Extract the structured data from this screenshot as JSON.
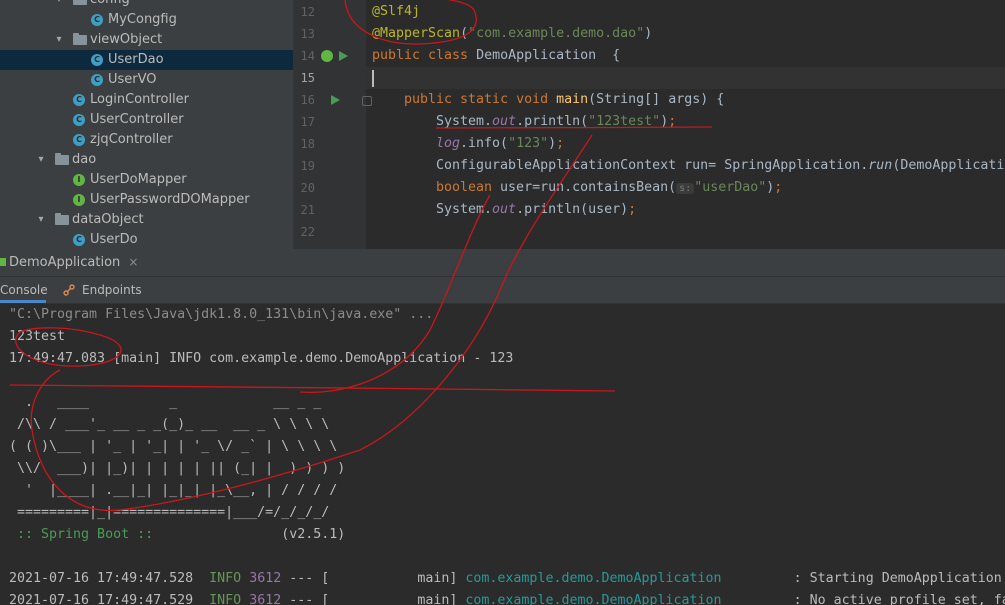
{
  "project_tree": {
    "items": [
      {
        "label": "config",
        "type": "folder",
        "expanded": true
      },
      {
        "label": "MyCongfig",
        "type": "class"
      },
      {
        "label": "viewObject",
        "type": "folder",
        "expanded": true
      },
      {
        "label": "UserDao",
        "type": "class",
        "selected": true
      },
      {
        "label": "UserVO",
        "type": "class"
      },
      {
        "label": "LoginController",
        "type": "class"
      },
      {
        "label": "UserController",
        "type": "class"
      },
      {
        "label": "zjqController",
        "type": "class"
      },
      {
        "label": "dao",
        "type": "folder",
        "expanded": true
      },
      {
        "label": "UserDoMapper",
        "type": "interface"
      },
      {
        "label": "UserPasswordDOMapper",
        "type": "interface"
      },
      {
        "label": "dataObject",
        "type": "folder",
        "expanded": true
      },
      {
        "label": "UserDo",
        "type": "class"
      }
    ]
  },
  "editor": {
    "line_numbers": [
      "12",
      "13",
      "14",
      "15",
      "16",
      "17",
      "18",
      "19",
      "20",
      "21",
      "22"
    ],
    "current_line": "15",
    "code": {
      "l12_ann": "@Slf4j",
      "l13_ann": "@MapperScan",
      "l13_open": "(",
      "l13_str": "\"com.example.demo.dao\"",
      "l13_close": ")",
      "l14_kw": "public class ",
      "l14_name": "DemoApplication  {",
      "l16_kw": "public static void ",
      "l16_fn": "main",
      "l16_rest": "(String[] args) {",
      "l17_a": "System.",
      "l17_b": "out",
      "l17_c": ".println(",
      "l17_d": "\"123test\"",
      "l17_e": ")",
      "l17_f": ";",
      "l18_a": "log",
      "l18_b": ".info(",
      "l18_c": "\"123\"",
      "l18_d": ")",
      "l18_e": ";",
      "l19_a": "ConfigurableApplicationContext run= SpringApplication.",
      "l19_b": "run",
      "l19_c": "(DemoApplicati",
      "l20_a": "boolean ",
      "l20_b": "user=run.containsBean(",
      "l20_hint": "s:",
      "l20_c": "\"userDao\"",
      "l20_d": ")",
      "l20_e": ";",
      "l21_a": "System.",
      "l21_b": "out",
      "l21_c": ".println(user)",
      "l21_d": ";"
    }
  },
  "run_window": {
    "tab_label": "DemoApplication",
    "tab_close": "×",
    "subtabs": [
      "Console",
      "Endpoints"
    ]
  },
  "console": {
    "lines": [
      "\"C:\\Program Files\\Java\\jdk1.8.0_131\\bin\\java.exe\" ...",
      "123test",
      "17:49:47.083 [main] INFO com.example.demo.DemoApplication - 123"
    ],
    "banner": [
      "  .   ____          _            __ _ _",
      " /\\\\ / ___'_ __ _ _(_)_ __  __ _ \\ \\ \\ \\",
      "( ( )\\___ | '_ | '_| | '_ \\/ _` | \\ \\ \\ \\",
      " \\\\/  ___)| |_)| | | | | || (_| |  ) ) ) )",
      "  '  |____| .__|_| |_|_| |_\\__, | / / / /",
      " =========|_|==============|___/=/_/_/_/"
    ],
    "spring_boot_label": " :: Spring Boot :: ",
    "spring_boot_version": "               (v2.5.1)",
    "log_lines": [
      {
        "timestamp": "2021-07-16 17:49:47.528",
        "level": "INFO",
        "pid": "3612",
        "sep": "---",
        "thread": "[           main]",
        "logger": "com.example.demo.DemoApplication",
        "message": ": Starting DemoApplication"
      },
      {
        "timestamp": "2021-07-16 17:49:47.529",
        "level": "INFO",
        "pid": "3612",
        "sep": "---",
        "thread": "[           main]",
        "logger": "com.example.demo.DemoApplication",
        "message": ": No active profile set, fa"
      }
    ]
  },
  "colors": {
    "annotation_red": "#c8171d",
    "keyword": "#cc7832",
    "annotation": "#bbb529",
    "string": "#6a8759",
    "selection": "#0d293e"
  }
}
